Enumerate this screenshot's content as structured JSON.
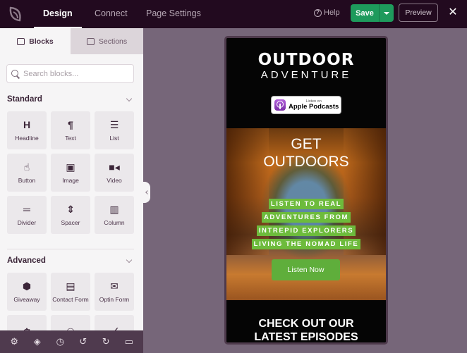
{
  "topbar": {
    "tabs": [
      {
        "label": "Design",
        "active": true
      },
      {
        "label": "Connect",
        "active": false
      },
      {
        "label": "Page Settings",
        "active": false
      }
    ],
    "help_label": "Help",
    "save_label": "Save",
    "preview_label": "Preview",
    "close_icon": "close-icon"
  },
  "sidebar": {
    "tabs": {
      "blocks": "Blocks",
      "sections": "Sections"
    },
    "search": {
      "placeholder": "Search blocks...",
      "value": ""
    },
    "standard": {
      "title": "Standard",
      "blocks": [
        {
          "label": "Headline",
          "icon": "headline-icon"
        },
        {
          "label": "Text",
          "icon": "paragraph-icon"
        },
        {
          "label": "List",
          "icon": "list-icon"
        },
        {
          "label": "Button",
          "icon": "pointer-icon"
        },
        {
          "label": "Image",
          "icon": "image-icon"
        },
        {
          "label": "Video",
          "icon": "video-icon"
        },
        {
          "label": "Divider",
          "icon": "divider-icon"
        },
        {
          "label": "Spacer",
          "icon": "spacer-icon"
        },
        {
          "label": "Column",
          "icon": "column-icon"
        }
      ]
    },
    "advanced": {
      "title": "Advanced",
      "blocks": [
        {
          "label": "Giveaway",
          "icon": "giveaway-icon"
        },
        {
          "label": "Contact Form",
          "icon": "contact-form-icon"
        },
        {
          "label": "Optin Form",
          "icon": "envelope-icon"
        },
        {
          "label": "",
          "icon": "timer-icon"
        },
        {
          "label": "",
          "icon": "social-icon"
        },
        {
          "label": "",
          "icon": "share-icon"
        }
      ]
    },
    "bottom_toolbar": [
      "settings",
      "layers",
      "history",
      "undo",
      "redo",
      "desktop-preview"
    ]
  },
  "preview": {
    "header": {
      "title": "OUTDOOR",
      "subtitle": "ADVENTURE",
      "badge_small": "Listen on",
      "badge_big": "Apple Podcasts"
    },
    "hero": {
      "title_lines": [
        "GET",
        "OUTDOORS"
      ],
      "highlight_lines": [
        "LISTEN TO REAL",
        "ADVENTURES FROM",
        "INTREPID EXPLORERS",
        "LIVING THE NOMAD LIFE"
      ],
      "button_label": "Listen Now"
    },
    "episodes": {
      "title_lines": [
        "CHECK OUT OUR",
        "LATEST EPISODES"
      ]
    }
  },
  "colors": {
    "topbar_bg": "#220a1f",
    "save_green": "#1e9a5c",
    "canvas_bg": "#766679",
    "highlight_green": "#6dbb3c",
    "button_green": "#5fae3b"
  }
}
